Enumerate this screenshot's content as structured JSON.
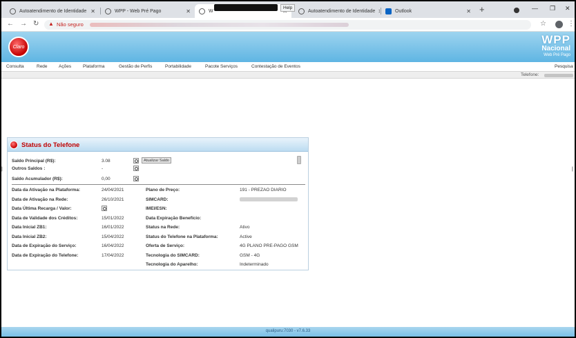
{
  "browser": {
    "tabs": [
      {
        "title": "Autoatendimento de Identidade",
        "icon": "globe-icon"
      },
      {
        "title": "WPP - Web Pré Pago",
        "icon": "globe-icon"
      },
      {
        "title": "W",
        "icon": "globe-icon"
      },
      {
        "title": "Autoatendimento de Identidade",
        "icon": "globe-icon"
      },
      {
        "title": "Outlook",
        "icon": "outlook-icon"
      }
    ],
    "help_badge": "Help",
    "security_label": "Não seguro"
  },
  "app": {
    "logo_text": "Claro",
    "brand": {
      "line1": "WPP",
      "line2": "Nacional",
      "line3": "Web Pré Pago"
    },
    "menu": [
      "Consulta",
      "Rede",
      "Ações",
      "Plataforma",
      "Gestão de Perfis",
      "Portabilidade",
      "Pacote Serviços",
      "Contestação de Eventos",
      "Pesquisa"
    ],
    "telefone_label": "Telefone:"
  },
  "panel": {
    "title": "Status do Telefone",
    "update_button": "Atualizar Saldo",
    "saldos": [
      {
        "label": "Saldo Principal (R$):",
        "value": "3.08"
      },
      {
        "label": "Outros Saldos :",
        "value": "-"
      },
      {
        "label": "Saldo Acumulador (R$):",
        "value": "0,00"
      }
    ],
    "left_fields": [
      {
        "label": "Data da Ativação na Plataforma:",
        "value": "24/04/2021"
      },
      {
        "label": "Data de Ativação na Rede:",
        "value": "26/10/2021"
      },
      {
        "label": "Data Última Recarga / Valor:",
        "value": ""
      },
      {
        "label": "Data de Validade dos Créditos:",
        "value": "15/01/2022"
      },
      {
        "label": "Data Inicial ZB1:",
        "value": "16/01/2022"
      },
      {
        "label": "Data Inicial ZB2:",
        "value": "15/04/2022"
      },
      {
        "label": "Data de Expiração do Serviço:",
        "value": "16/04/2022"
      },
      {
        "label": "Data de Expiração do Telefone:",
        "value": "17/04/2022"
      }
    ],
    "right_fields": [
      {
        "label": "Plano de Preço:",
        "value": "191 - PREZAO DIARIO"
      },
      {
        "label": "SIMCARD:",
        "value": ""
      },
      {
        "label": "IMEI/ESN:",
        "value": ""
      },
      {
        "label": "Data Expiração Benefício:",
        "value": ""
      },
      {
        "label": "Status na Rede:",
        "value": "Ativo"
      },
      {
        "label": "Status do Telefone na Plataforma:",
        "value": "Active"
      },
      {
        "label": "Oferta de Serviço:",
        "value": "4G PLANO PRE-PAGO GSM"
      },
      {
        "label": "Tecnologia do SIMCARD:",
        "value": "GSM - 4G"
      },
      {
        "label": "Tecnologia do Aparelho:",
        "value": "Indeterminado"
      }
    ]
  },
  "footer": {
    "text": "qualipuru:7030 - v7.6.33"
  }
}
